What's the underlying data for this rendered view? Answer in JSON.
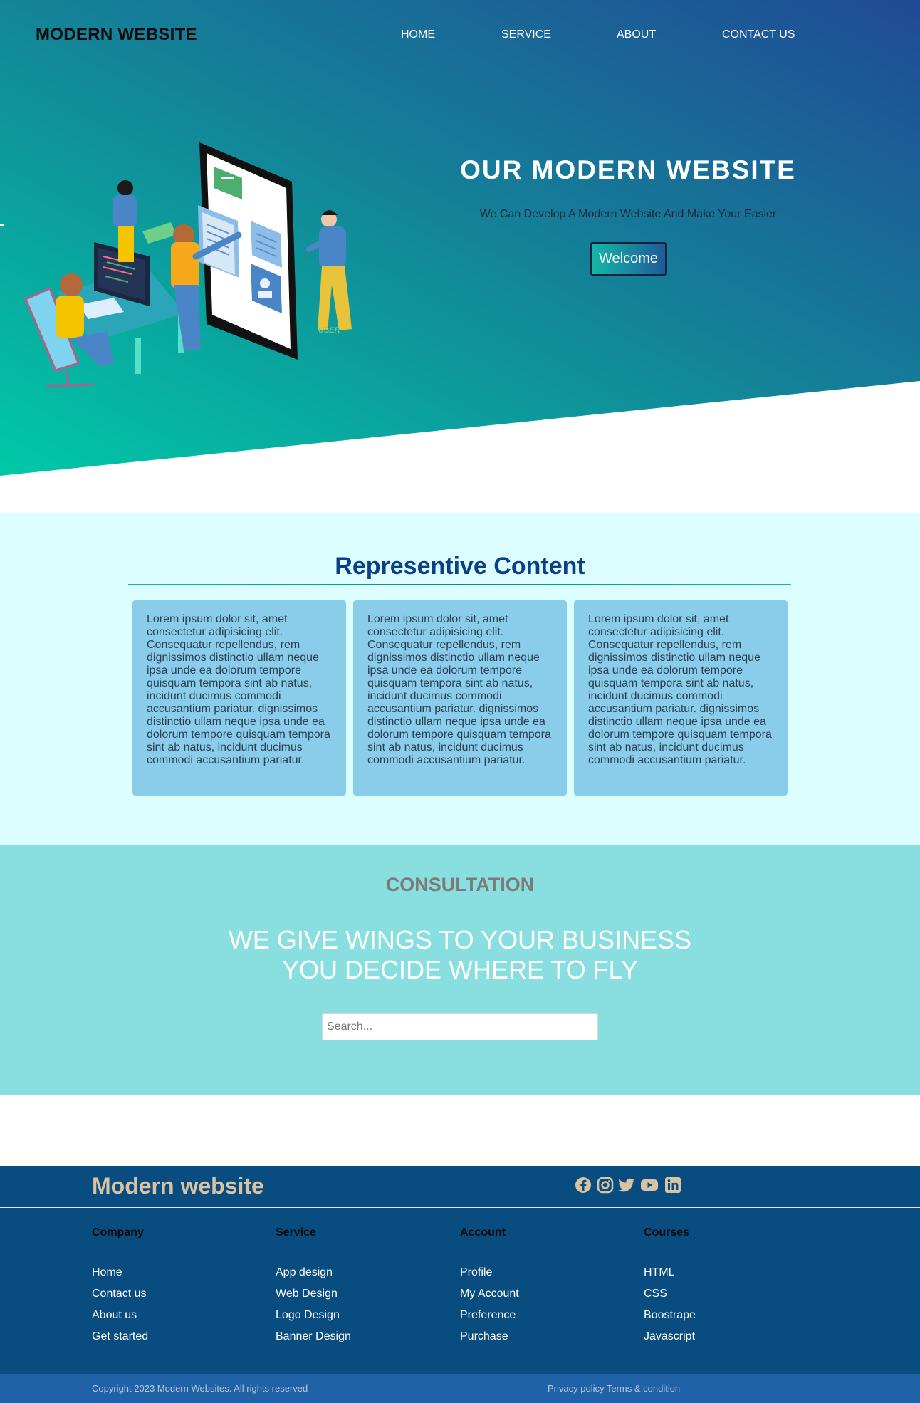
{
  "header": {
    "brand": "MODERN WEBSITE",
    "nav": [
      "HOME",
      "SERVICE",
      "ABOUT",
      "CONTACT US"
    ]
  },
  "hero": {
    "title": "OUR MODERN WEBSITE",
    "subtitle": "We Can Develop A Modern Website And Make Your Easier",
    "button_label": "Welcome",
    "illustration_label": "USER",
    "colors": {
      "gradient_start": "#00c9a7",
      "gradient_end": "#204a96"
    }
  },
  "content": {
    "title": "Representive Content",
    "cards": [
      {
        "text": "Lorem ipsum dolor sit, amet consectetur adipisicing elit. Consequatur repellendus, rem dignissimos distinctio ullam neque ipsa unde ea dolorum tempore quisquam tempora sint ab natus, incidunt ducimus commodi accusantium pariatur. dignissimos distinctio ullam neque ipsa unde ea dolorum tempore quisquam tempora sint ab natus, incidunt ducimus commodi accusantium pariatur."
      },
      {
        "text": "Lorem ipsum dolor sit, amet consectetur adipisicing elit. Consequatur repellendus, rem dignissimos distinctio ullam neque ipsa unde ea dolorum tempore quisquam tempora sint ab natus, incidunt ducimus commodi accusantium pariatur. dignissimos distinctio ullam neque ipsa unde ea dolorum tempore quisquam tempora sint ab natus, incidunt ducimus commodi accusantium pariatur."
      },
      {
        "text": "Lorem ipsum dolor sit, amet consectetur adipisicing elit. Consequatur repellendus, rem dignissimos distinctio ullam neque ipsa unde ea dolorum tempore quisquam tempora sint ab natus, incidunt ducimus commodi accusantium pariatur. dignissimos distinctio ullam neque ipsa unde ea dolorum tempore quisquam tempora sint ab natus, incidunt ducimus commodi accusantium pariatur."
      }
    ]
  },
  "consultation": {
    "label": "CONSULTATION",
    "line1": "WE GIVE WINGS TO YOUR BUSINESS",
    "line2": "YOU DECIDE WHERE TO FLY",
    "search_placeholder": "Search..."
  },
  "footer": {
    "brand": "Modern website",
    "social_icons": [
      "facebook-icon",
      "instagram-icon",
      "twitter-icon",
      "youtube-icon",
      "linkedin-icon"
    ],
    "columns": [
      {
        "heading": "Company",
        "links": [
          "Home",
          "Contact us",
          "About us",
          "Get started"
        ]
      },
      {
        "heading": "Service",
        "links": [
          "App design",
          "Web Design",
          "Logo Design",
          "Banner Design"
        ]
      },
      {
        "heading": "Account",
        "links": [
          "Profile",
          "My Account",
          "Preference",
          "Purchase"
        ]
      },
      {
        "heading": "Courses",
        "links": [
          "HTML",
          "CSS",
          "Boostrape",
          "Javascript"
        ]
      }
    ],
    "copyright": "Copyright 2023 Modern Websites. All rights reserved",
    "legal": "Privacy policy Terms & condition"
  }
}
